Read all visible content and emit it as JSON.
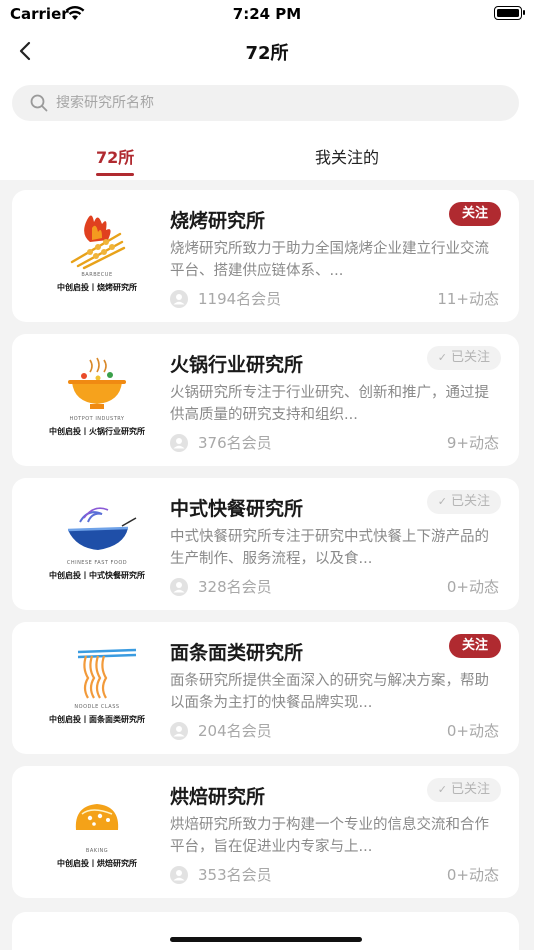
{
  "status_bar": {
    "carrier": "Carrier",
    "time": "7:24 PM"
  },
  "nav": {
    "title": "72所",
    "back_icon": "chevron-left-icon"
  },
  "search": {
    "placeholder": "搜索研究所名称"
  },
  "tabs": [
    {
      "label": "72所",
      "active": true
    },
    {
      "label": "我关注的",
      "active": false
    }
  ],
  "colors": {
    "accent": "#b02a30",
    "followed_bg": "#f2f2f2"
  },
  "institutes": [
    {
      "title": "烧烤研究所",
      "description": "烧烤研究所致力于助力全国烧烤企业建立行业交流平台、搭建供应链体系、...",
      "members": "1194名会员",
      "activity": "11+动态",
      "follow_label": "关注",
      "followed": false,
      "logo_en": "BARBECUE",
      "logo_caption": "中创启投丨烧烤研究所",
      "logo_icon": "barbecue-skewer-icon"
    },
    {
      "title": "火锅行业研究所",
      "description": "火锅研究所专注于行业研究、创新和推广，通过提供高质量的研究支持和组织...",
      "members": "376名会员",
      "activity": "9+动态",
      "follow_label": "已关注",
      "followed": true,
      "logo_en": "HOTPOT INDUSTRY",
      "logo_caption": "中创启投丨火锅行业研究所",
      "logo_icon": "hotpot-icon"
    },
    {
      "title": "中式快餐研究所",
      "description": "中式快餐研究所专注于研究中式快餐上下游产品的生产制作、服务流程，以及食...",
      "members": "328名会员",
      "activity": "0+动态",
      "follow_label": "已关注",
      "followed": true,
      "logo_en": "CHINESE FAST FOOD",
      "logo_caption": "中创启投丨中式快餐研究所",
      "logo_icon": "noodle-bowl-icon"
    },
    {
      "title": "面条面类研究所",
      "description": "面条研究所提供全面深入的研究与解决方案，帮助以面条为主打的快餐品牌实现...",
      "members": "204名会员",
      "activity": "0+动态",
      "follow_label": "关注",
      "followed": false,
      "logo_en": "NOODLE CLASS",
      "logo_caption": "中创启投丨面条面类研究所",
      "logo_icon": "noodles-chopsticks-icon"
    },
    {
      "title": "烘焙研究所",
      "description": "烘焙研究所致力于构建一个专业的信息交流和合作平台，旨在促进业内专家与上...",
      "members": "353名会员",
      "activity": "0+动态",
      "follow_label": "已关注",
      "followed": true,
      "logo_en": "BAKING",
      "logo_caption": "中创启投丨烘焙研究所",
      "logo_icon": "bread-bun-icon"
    }
  ]
}
